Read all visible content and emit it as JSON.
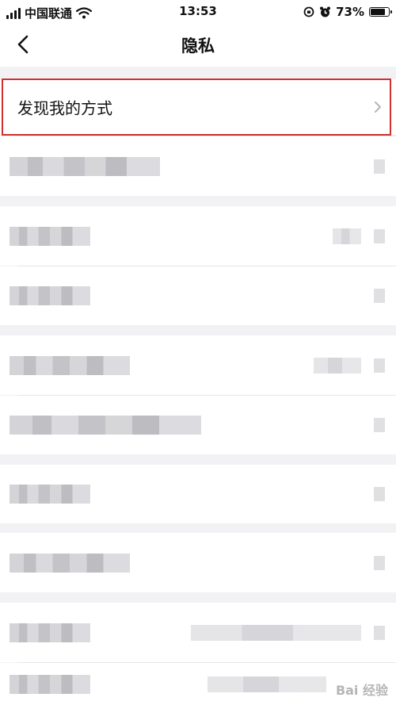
{
  "status_bar": {
    "carrier": "中国联通",
    "time": "13:53",
    "battery": "73%"
  },
  "nav": {
    "title": "隐私"
  },
  "highlighted_row": {
    "label": "发现我的方式"
  },
  "watermark": "Bai 经验"
}
